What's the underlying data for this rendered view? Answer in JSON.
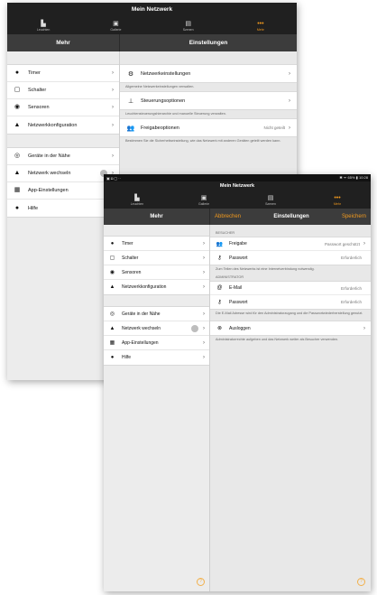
{
  "app": {
    "title": "Mein Netzwerk"
  },
  "tabs": [
    {
      "label": "Leuchten",
      "icon": "lamp-icon"
    },
    {
      "label": "Gallerie",
      "icon": "gallery-icon"
    },
    {
      "label": "Szenen",
      "icon": "scene-icon"
    },
    {
      "label": "Mehr",
      "icon": "more-icon",
      "active": true
    }
  ],
  "accent_color": "#f39a1e",
  "left_header": "Mehr",
  "nav": {
    "group1": [
      {
        "label": "Timer",
        "icon": "clock-icon"
      },
      {
        "label": "Schalter",
        "icon": "switch-icon"
      },
      {
        "label": "Sensoren",
        "icon": "sensor-icon"
      },
      {
        "label": "Netzwerkkonfiguration",
        "icon": "network-config-icon"
      }
    ],
    "group2": [
      {
        "label": "Geräte in der Nähe",
        "icon": "nearby-devices-icon"
      },
      {
        "label": "Netzwerk wechseln",
        "icon": "switch-network-icon"
      },
      {
        "label": "App-Einstellungen",
        "icon": "app-settings-icon"
      },
      {
        "label": "Hilfe",
        "icon": "help-icon"
      }
    ]
  },
  "screen1": {
    "header": "Einstellungen",
    "rows": [
      {
        "label": "Netzwerkeinstellungen",
        "note": "Allgemeine Netzwerkeinstellungen verwalten."
      },
      {
        "label": "Steuerungsoptionen",
        "note": "Leuchtensteuerungshierarchie und manuelle Steuerung verwalten."
      },
      {
        "label": "Freigabeoptionen",
        "value": "Nicht geteilt",
        "note": "Bestimmen Sie die Sicherheitseinstellung, wie das Netzwerk mit anderen Geräten geteilt werden kann."
      }
    ]
  },
  "screen2": {
    "status_right": "✱ ᯤ 65% ▮ 10:28",
    "cancel": "Abbrechen",
    "header": "Einstellungen",
    "save": "Speichern",
    "guest_section": "BESUCHER",
    "share_label": "Freigabe",
    "share_value": "Passwort geschützt",
    "guest_password_label": "Passwort",
    "guest_password_value": "Erforderlich",
    "guest_note": "Zum Teilen des Netzwerks ist eine Internetverbindung notwendig.",
    "admin_section": "ADMINISTRATOR",
    "email_label": "E-Mail",
    "email_value": "Erforderlich",
    "admin_password_label": "Passwort",
    "admin_password_value": "Erforderlich",
    "admin_note": "Die E-Mail Adresse wird für den Administratorzugang und die Passwortwiederherstellung genutzt.",
    "logout_label": "Ausloggen",
    "logout_note": "Administratorrechte aufgeben und das Netzwerk weiter als Besucher verwenden."
  }
}
